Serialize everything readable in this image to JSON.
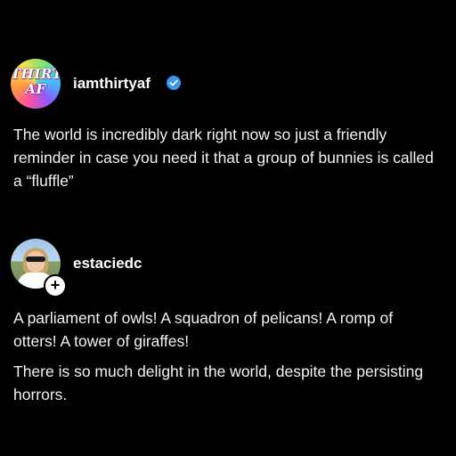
{
  "posts": [
    {
      "username": "iamthirtyaf",
      "verified": true,
      "avatar_text": [
        "THIRTY",
        "AF"
      ],
      "text": "The world is incredibly dark right now so just a friendly reminder in case you need it that a group of bunnies is called a “fluffle”"
    },
    {
      "username": "estaciedc",
      "verified": false,
      "follow_badge": "+",
      "paragraphs": [
        "A parliament of owls! A squadron of pelicans! A romp of otters! A tower of giraffes!",
        "There is so much delight in the world, despite the persisting horrors."
      ]
    }
  ],
  "colors": {
    "background": "#000000",
    "text": "#ffffff",
    "verified_badge": "#3897f0"
  },
  "icons": {
    "verified": "verified-check-icon",
    "follow": "plus-icon"
  }
}
